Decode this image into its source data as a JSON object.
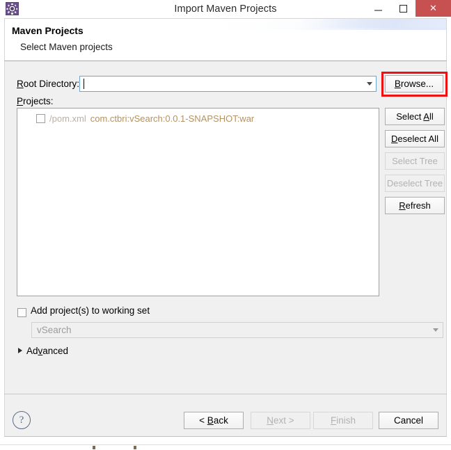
{
  "window": {
    "title": "Import Maven Projects",
    "icon": "maven-cog-icon",
    "controls": {
      "minimize": "–",
      "maximize": "□",
      "close": "✕"
    }
  },
  "header": {
    "title": "Maven Projects",
    "subtitle": "Select Maven projects"
  },
  "form": {
    "root_directory_label": "Root Directory:",
    "root_directory_label_mnemonic": "R",
    "root_directory_value": "",
    "root_directory_placeholder": "",
    "browse_label": "Browse...",
    "browse_label_mnemonic": "B",
    "projects_label": "Projects:",
    "projects_label_mnemonic": "P"
  },
  "annotation": {
    "color": "#ee1111",
    "target": "browse-button"
  },
  "tree": {
    "rows": [
      {
        "checked": false,
        "path": "/pom.xml",
        "coordinates": "com.ctbri:vSearch:0.0.1-SNAPSHOT:war",
        "path_color": "#b9b0a8",
        "coordinates_color": "#b39263"
      }
    ]
  },
  "side_buttons": [
    {
      "label": "Select All",
      "mnemonic": "A",
      "enabled": true
    },
    {
      "label": "Deselect All",
      "mnemonic": "D",
      "enabled": true
    },
    {
      "label": "Select Tree",
      "mnemonic": "",
      "enabled": false
    },
    {
      "label": "Deselect Tree",
      "mnemonic": "",
      "enabled": false
    },
    {
      "label": "Refresh",
      "mnemonic": "R",
      "enabled": true
    }
  ],
  "working_set": {
    "checkbox_label": "Add project(s) to working set",
    "checked": false,
    "combo_value": "vSearch",
    "combo_enabled": false
  },
  "advanced": {
    "label": "Advanced",
    "mnemonic": "v",
    "expanded": false
  },
  "footer": {
    "help_glyph": "?",
    "buttons": [
      {
        "label": "< Back",
        "mnemonic": "B",
        "enabled": true
      },
      {
        "label": "Next >",
        "mnemonic": "N",
        "enabled": false
      },
      {
        "label": "Finish",
        "mnemonic": "F",
        "enabled": false
      },
      {
        "label": "Cancel",
        "mnemonic": "",
        "enabled": true
      }
    ]
  }
}
